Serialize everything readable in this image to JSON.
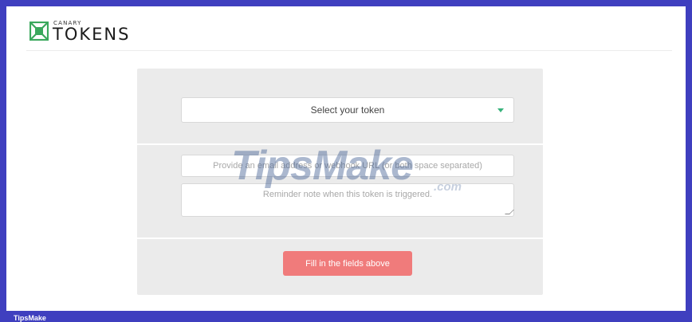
{
  "brand": {
    "small": "CANARY",
    "big": "TOKENS"
  },
  "form": {
    "select_label": "Select your token",
    "email_placeholder": "Provide an email address or webhook URL (or both space separated)",
    "note_placeholder": "Reminder note when this token is triggered.",
    "submit_label": "Fill in the fields above"
  },
  "watermark": {
    "main": "TipsMake",
    "sub": ".com"
  },
  "footer": {
    "label": "TipsMake"
  },
  "colors": {
    "accent_green": "#37b37b",
    "button": "#f07b7b",
    "frame": "#3f3fbf",
    "card": "#ebebeb"
  }
}
